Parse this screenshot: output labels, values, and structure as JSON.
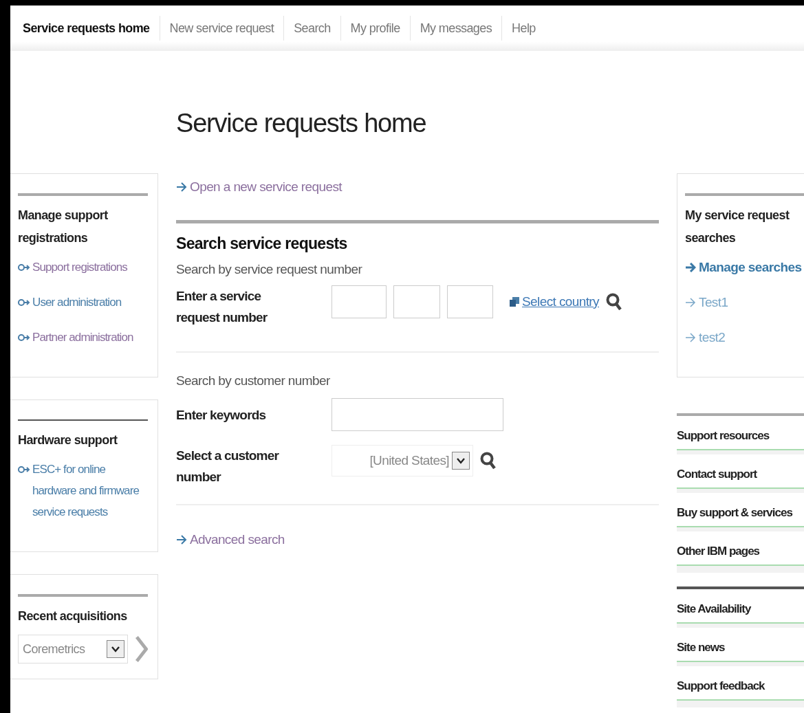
{
  "nav": [
    {
      "label": "Service requests home",
      "selected": true
    },
    {
      "label": "New service request",
      "selected": false
    },
    {
      "label": "Search",
      "selected": false
    },
    {
      "label": "My profile",
      "selected": false
    },
    {
      "label": "My messages",
      "selected": false
    },
    {
      "label": "Help",
      "selected": false
    }
  ],
  "title": "Service requests home",
  "left_panels": [
    {
      "title": "Manage support registrations",
      "links": [
        {
          "label": "Support registrations",
          "visited": true
        },
        {
          "label": "User administration",
          "visited": false
        },
        {
          "label": "Partner administration",
          "visited": true
        }
      ]
    },
    {
      "title": "Hardware support",
      "links": [
        {
          "label": "ESC+ for online hardware and firmware service requests",
          "visited": false
        }
      ]
    },
    {
      "title": "Recent acquisitions",
      "select": {
        "value": "Coremetrics"
      }
    }
  ],
  "main": {
    "open_link": "Open a new service request",
    "heading": "Search service requests",
    "by_number": {
      "title": "Search by service request number",
      "label": "Enter a service request number",
      "country_link": "Select country"
    },
    "by_customer": {
      "title": "Search by customer number",
      "keywords_label": "Enter keywords",
      "customer_label": "Select a customer number",
      "customer_value": "[United States]"
    },
    "advanced_link": "Advanced search"
  },
  "right_panel": {
    "title": "My service request searches",
    "links": [
      {
        "label": "Manage searches",
        "kind": "action"
      },
      {
        "label": "Test1",
        "kind": "saved"
      },
      {
        "label": "test2",
        "kind": "saved"
      }
    ]
  },
  "right_lists": [
    [
      "Support resources",
      "Contact support",
      "Buy support & services",
      "Other IBM pages"
    ],
    [
      "Site Availability",
      "Site news",
      "Support feedback"
    ]
  ]
}
